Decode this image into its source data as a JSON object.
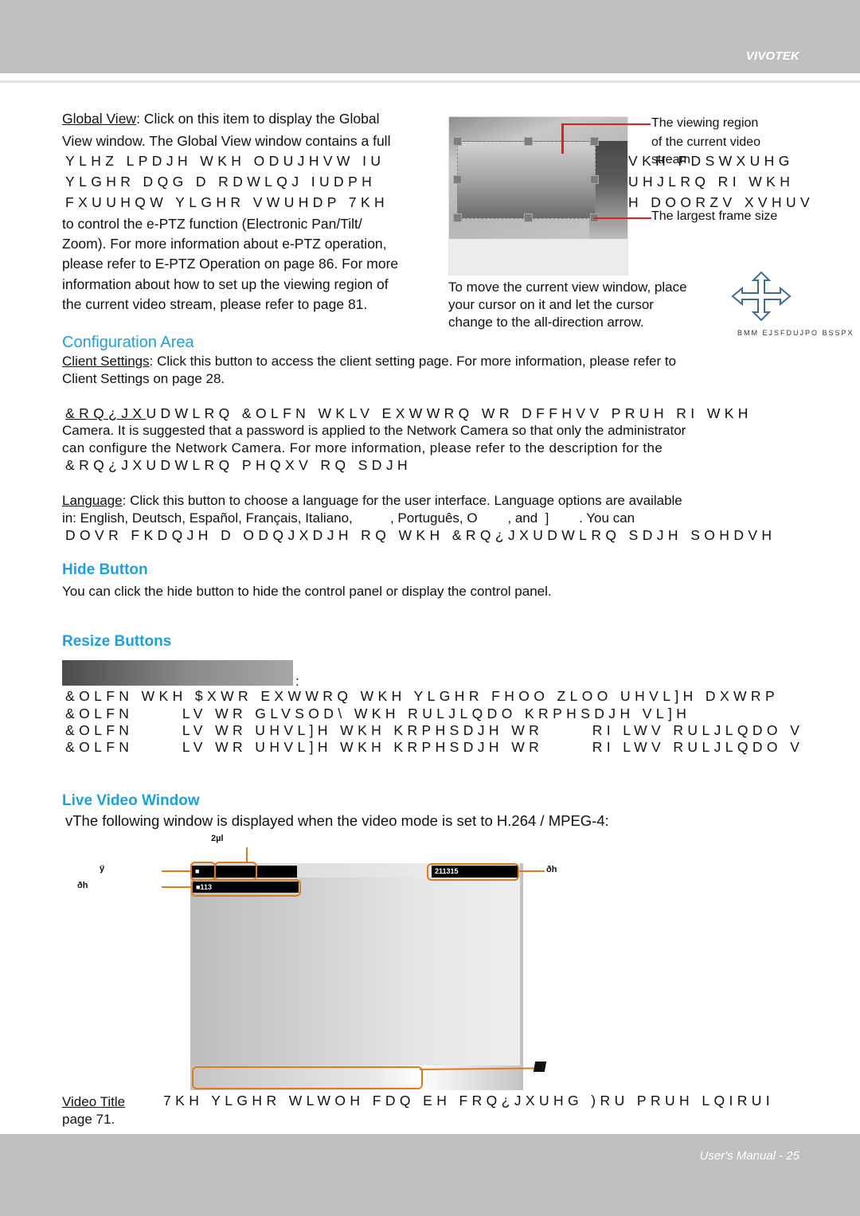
{
  "header": {
    "brand": "VIVOTEK"
  },
  "footer": {
    "page_label": "User's Manual - 25"
  },
  "global_view": {
    "term": "Global View",
    "line1_rest": ": Click on this item to display the Global",
    "line2": "View window. The Global View window contains a full",
    "line3_encoded": "YLHZ LPDJH WKH ODUJHVW IU",
    "line4_encoded": "YLGHR DQG D RDWLQJ IUDPH",
    "line5_encoded": "FXUUHQW YLGHR VWUHDP 7KH",
    "line6": "to control the e-PTZ function (Electronic Pan/Tilt/",
    "line7": "Zoom). For more information about e-PTZ operation,",
    "line8": "please refer to E-PTZ Operation on page 86. For more",
    "line9": "information about how to set up the viewing region of",
    "line10": "the current video stream, please refer to page 81.",
    "right_encoded_1": "VKH FDSWXUHG",
    "right_encoded_2": "UHJLRQ RI WKH",
    "right_encoded_3": "H DOORZV XVHUV",
    "callout_region_1": "The viewing region",
    "callout_region_2": "of the current video",
    "callout_region_3": "stream",
    "callout_frame": "The largest frame size",
    "move_text_1": "To move the current view window, place",
    "move_text_2": "your cursor on it and let the cursor",
    "move_text_3": "change to the all-direction arrow.",
    "arrow_caption": "BMM EJSFDUJPO BSSPX",
    "arrow_icon": "all-direction-arrow-icon"
  },
  "configuration_area": {
    "heading": "Configuration Area",
    "client_settings_term": "Client Settings",
    "client_settings_rest": ": Click this button to access the client setting page. For more information, please refer to",
    "client_settings_line2": "Client Settings on page 28.",
    "configuration_term_encoded": "&RQ¿JX",
    "configuration_rest_encoded": "UDWLRQ &OLFN WKLV EXWWRQ WR DFFHVV PRUH RI WKH",
    "configuration_line2": "Camera. It is suggested that a password is applied to the Network Camera so that only the administrator",
    "configuration_line3": "can configure the Network Camera. For more information, please refer to the description for the",
    "configuration_line4_encoded": "&RQ¿JXUDWLRQ PHQXV RQ SDJH",
    "language_term": "Language",
    "language_rest": ": Click this button to choose a language for the user interface. Language options are available",
    "language_line2": "in: English, Deutsch, Español, Français, Italiano,          , Português, O        , and  ]        . You can",
    "language_line3_encoded": "DOVR FKDQJH D ODQJXDJH RQ WKH &RQ¿JXUDWLRQ SDJH SOHDVH"
  },
  "hide_button": {
    "heading": "Hide Button",
    "text": "You can click the hide button to hide the control panel or display the control panel."
  },
  "resize_buttons": {
    "heading": "Resize Buttons",
    "colon": ":",
    "lines_encoded": [
      "&OLFN WKH $XWR EXWWRQ WKH YLGHR FHOO ZLOO UHVL]H DXWRP",
      "&OLFN      LV WR GLVSOD\\ WKH RULJLQDO KRPHSDJH VL]H",
      "&OLFN      LV WR UHVL]H WKH KRPHSDJH WR      RI LWV RULJLQDO V",
      "&OLFN      LV WR UHVL]H WKH KRPHSDJH WR      RI LWV RULJLQDO V"
    ]
  },
  "live_video_window": {
    "heading": "Live Video Window",
    "intro": "vThe following window is displayed when the video mode is set to H.264 / MPEG-4:",
    "callout_top": "2µl",
    "callout_left_1": "ÿ",
    "callout_left_2": "ðh",
    "callout_right": "ðh",
    "title_bar_left": "■",
    "stream_label": "■113",
    "timestamp": "211315",
    "video_title_term": "Video Title",
    "video_title_rest_encoded": "7KH YLGHR WLWOH FDQ EH FRQ¿JXUHG )RU PRUH LQIRUI",
    "video_title_line2": "page 71."
  },
  "colors": {
    "header_gray": "#bfc1c0",
    "heading_blue": "#1ba1e2",
    "callout_red": "#e02020",
    "callout_orange": "#e07a1e"
  }
}
